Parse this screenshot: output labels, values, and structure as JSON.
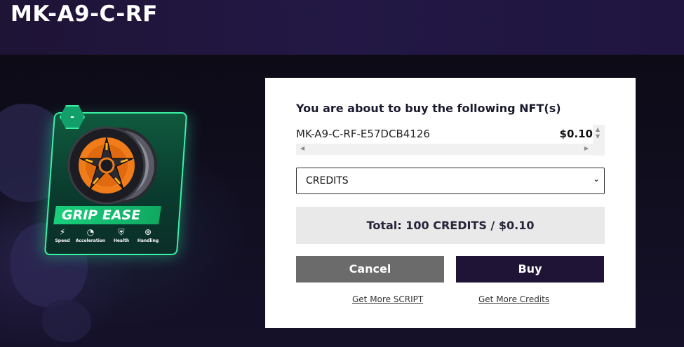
{
  "header": {
    "title": "MK-A9-C-RF"
  },
  "nft_card": {
    "badge": "-",
    "name": "GRIP EASE",
    "stats": [
      {
        "icon": "lightning-icon",
        "label": "Speed"
      },
      {
        "icon": "gauge-icon",
        "label": "Acceleration"
      },
      {
        "icon": "shield-icon",
        "label": "Health"
      },
      {
        "icon": "steering-wheel-icon",
        "label": "Handling"
      }
    ]
  },
  "purchase": {
    "heading": "You are about to buy the following NFT(s)",
    "items": [
      {
        "name": "MK-A9-C-RF-E57DCB4126",
        "price": "$0.10"
      }
    ],
    "currency_select": {
      "selected": "CREDITS"
    },
    "total": "Total: 100 CREDITS / $0.10",
    "cancel_label": "Cancel",
    "buy_label": "Buy",
    "link_script": "Get More SCRIPT",
    "link_credits": "Get More Credits"
  },
  "colors": {
    "header_bg": "#1e1436",
    "card_border": "#3af0a3",
    "buy_button": "#1f1436",
    "cancel_button": "#6b6b6b"
  }
}
